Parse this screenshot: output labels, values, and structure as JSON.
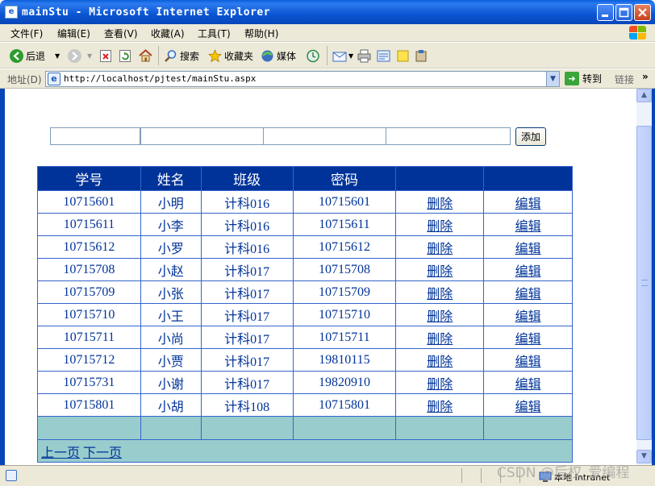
{
  "window": {
    "title": "mainStu - Microsoft Internet Explorer",
    "minimize_icon": "minimize-icon",
    "maximize_icon": "maximize-icon",
    "close_icon": "close-icon"
  },
  "menu": {
    "items": [
      "文件(F)",
      "编辑(E)",
      "查看(V)",
      "收藏(A)",
      "工具(T)",
      "帮助(H)"
    ]
  },
  "toolbar": {
    "back_label": "后退",
    "search_label": "搜索",
    "favorites_label": "收藏夹",
    "media_label": "媒体"
  },
  "address": {
    "label": "地址(D)",
    "url": "http://localhost/pjtest/mainStu.aspx",
    "go_label": "转到",
    "links_label": "链接"
  },
  "form": {
    "add_button": "添加",
    "fields": [
      "",
      "",
      "",
      ""
    ]
  },
  "table": {
    "headers": [
      "学号",
      "姓名",
      "班级",
      "密码",
      "",
      ""
    ],
    "rows": [
      {
        "id": "10715601",
        "name": "小明",
        "cls": "计科016",
        "pwd": "10715601"
      },
      {
        "id": "10715611",
        "name": "小李",
        "cls": "计科016",
        "pwd": "10715611"
      },
      {
        "id": "10715612",
        "name": "小罗",
        "cls": "计科016",
        "pwd": "10715612"
      },
      {
        "id": "10715708",
        "name": "小赵",
        "cls": "计科017",
        "pwd": "10715708"
      },
      {
        "id": "10715709",
        "name": "小张",
        "cls": "计科017",
        "pwd": "10715709"
      },
      {
        "id": "10715710",
        "name": "小王",
        "cls": "计科017",
        "pwd": "10715710"
      },
      {
        "id": "10715711",
        "name": "小尚",
        "cls": "计科017",
        "pwd": "10715711"
      },
      {
        "id": "10715712",
        "name": "小贾",
        "cls": "计科017",
        "pwd": "19810115"
      },
      {
        "id": "10715731",
        "name": "小谢",
        "cls": "计科017",
        "pwd": "19820910"
      },
      {
        "id": "10715801",
        "name": "小胡",
        "cls": "计科108",
        "pwd": "10715801"
      }
    ],
    "delete_label": "删除",
    "edit_label": "编辑",
    "prev_page": "上一页",
    "next_page": "下一页"
  },
  "status": {
    "zone": "本地 Intranet"
  },
  "watermark": "CSDN @后权_爱编程",
  "colors": {
    "header_bg": "#003399",
    "footer_bg": "#99cccc",
    "text": "#003399"
  }
}
